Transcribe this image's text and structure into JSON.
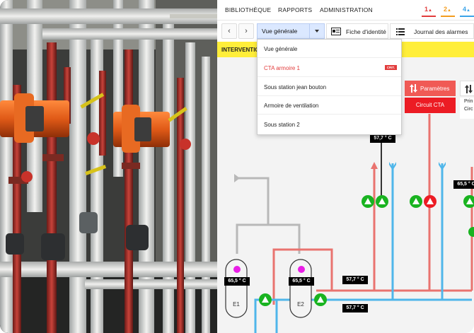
{
  "nav": {
    "items": [
      "BIBLIOTHÈQUE",
      "RAPPORTS",
      "ADMINISTRATION"
    ],
    "alarms": [
      {
        "count": "1",
        "color": "#e23b3b"
      },
      {
        "count": "2",
        "color": "#f39c1f"
      },
      {
        "count": "4",
        "color": "#3aa3e8"
      }
    ]
  },
  "toolbar": {
    "back": "‹",
    "forward": "›",
    "view_select": "Vue générale",
    "identity_label": "Fiche d'identité",
    "alarm_journal_label": "Journal des alarmes"
  },
  "banner": {
    "text": "INTERVENTIC"
  },
  "dropdown": {
    "options": [
      {
        "label": "Vue générale",
        "badge": ""
      },
      {
        "label": "CTA armoire 1",
        "badge": "CRIT."
      },
      {
        "label": "Sous station jean bouton",
        "badge": ""
      },
      {
        "label": "Armoire de ventilation",
        "badge": ""
      },
      {
        "label": "Sous station 2",
        "badge": ""
      }
    ]
  },
  "panel": {
    "params_label": "Paramètres",
    "circuit_label": "Circuit CTA",
    "side_text_1": "Prin",
    "side_text_2": "Circ"
  },
  "diagram": {
    "temps": [
      "57,7 ° C",
      "65,5 ° C",
      "65,5 ° C",
      "65,5 ° C",
      "57,7 ° C",
      "57,7 ° C"
    ],
    "tanks": [
      "E1",
      "E2"
    ],
    "hot_color": "#e9736f",
    "cold_color": "#4fb6ea",
    "gray_color": "#b8b8b8",
    "pump_on_color": "#19b320",
    "pump_alarm_color": "#ec1c24"
  }
}
